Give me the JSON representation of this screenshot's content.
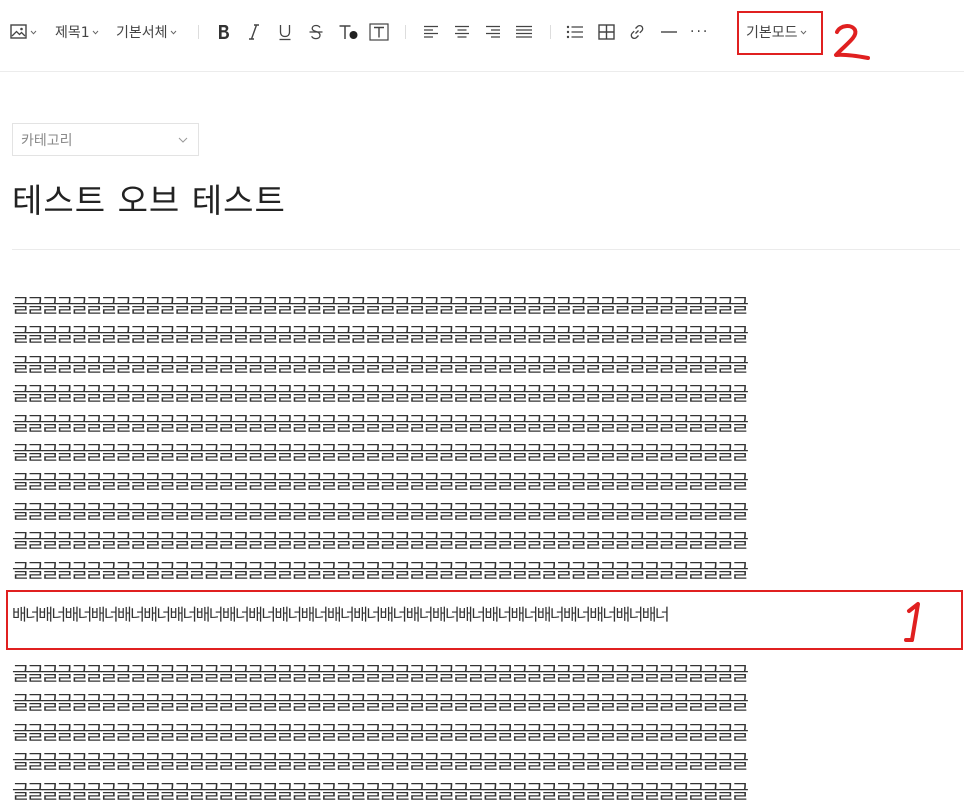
{
  "toolbar": {
    "heading_label": "제목1",
    "font_label": "기본서체",
    "mode_label": "기본모드",
    "more_label": "···"
  },
  "editor": {
    "category_placeholder": "카테고리",
    "title": "테스트 오브 테스트",
    "paragraph_top": [
      "글글글글글글글글글글글글글글글글글글글글글글글글글글글글글글글글글글글글글글글글글글글글글글글글글글",
      "글글글글글글글글글글글글글글글글글글글글글글글글글글글글글글글글글글글글글글글글글글글글글글글글글글",
      "글글글글글글글글글글글글글글글글글글글글글글글글글글글글글글글글글글글글글글글글글글글글글글글글글글",
      "글글글글글글글글글글글글글글글글글글글글글글글글글글글글글글글글글글글글글글글글글글글글글글글글글글",
      "글글글글글글글글글글글글글글글글글글글글글글글글글글글글글글글글글글글글글글글글글글글글글글글글글글",
      "글글글글글글글글글글글글글글글글글글글글글글글글글글글글글글글글글글글글글글글글글글글글글글글글글글",
      "글글글글글글글글글글글글글글글글글글글글글글글글글글글글글글글글글글글글글글글글글글글글글글글글글글",
      "글글글글글글글글글글글글글글글글글글글글글글글글글글글글글글글글글글글글글글글글글글글글글글글글글글",
      "글글글글글글글글글글글글글글글글글글글글글글글글글글글글글글글글글글글글글글글글글글글글글글글글글글",
      "글글글글글글글글글글글글글글글글글글글글글글글글글글글글글글글글글글글글글글글글글글글글글글글글글글"
    ],
    "banner_text": "배너배너배너배너배너배너배너배너배너배너배너배너배너배너배너배너배너배너배너배너배너배너배너배너배너",
    "paragraph_bottom": [
      "글글글글글글글글글글글글글글글글글글글글글글글글글글글글글글글글글글글글글글글글글글글글글글글글글글",
      "글글글글글글글글글글글글글글글글글글글글글글글글글글글글글글글글글글글글글글글글글글글글글글글글글글",
      "글글글글글글글글글글글글글글글글글글글글글글글글글글글글글글글글글글글글글글글글글글글글글글글글글글",
      "글글글글글글글글글글글글글글글글글글글글글글글글글글글글글글글글글글글글글글글글글글글글글글글글글글",
      "글글글글글글글글글글글글글글글글글글글글글글글글글글글글글글글글글글글글글글글글글글글글글글글글글글"
    ]
  },
  "annotations": {
    "label_1": "1",
    "label_2": "2",
    "color": "#e02020"
  },
  "icons": [
    "image-icon",
    "bold-icon",
    "italic-icon",
    "underline-icon",
    "strikethrough-icon",
    "text-color-icon",
    "text-background-icon",
    "align-left-icon",
    "align-center-icon",
    "align-right-icon",
    "align-justify-icon",
    "bullet-list-icon",
    "table-icon",
    "link-icon",
    "horizontal-rule-icon",
    "more-icon",
    "chevron-down-icon"
  ]
}
